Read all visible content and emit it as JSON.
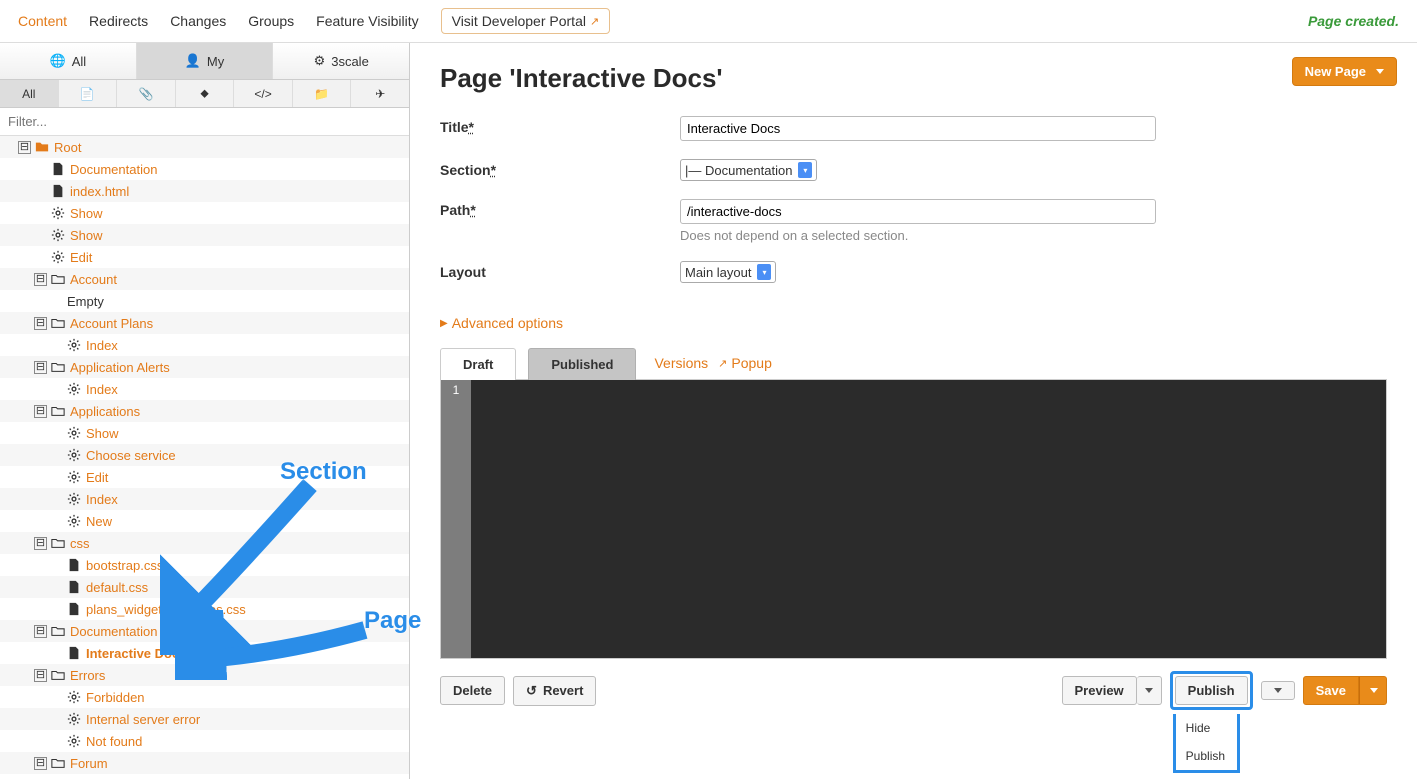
{
  "topnav": {
    "items": [
      "Content",
      "Redirects",
      "Changes",
      "Groups",
      "Feature Visibility"
    ],
    "dev_portal": "Visit Developer Portal",
    "status": "Page created."
  },
  "owner_tabs": [
    "All",
    "My",
    "3scale"
  ],
  "filter_placeholder": "Filter...",
  "tree": [
    {
      "depth": 0,
      "toggle": "-",
      "icon": "folder",
      "label": "Root",
      "link": true
    },
    {
      "depth": 1,
      "toggle": "",
      "icon": "file",
      "label": "Documentation",
      "link": true
    },
    {
      "depth": 1,
      "toggle": "",
      "icon": "file",
      "label": "index.html",
      "link": true
    },
    {
      "depth": 1,
      "toggle": "",
      "icon": "cog",
      "label": "Show",
      "link": true
    },
    {
      "depth": 1,
      "toggle": "",
      "icon": "cog",
      "label": "Show",
      "link": true
    },
    {
      "depth": 1,
      "toggle": "",
      "icon": "cog",
      "label": "Edit",
      "link": true
    },
    {
      "depth": 1,
      "toggle": "-",
      "icon": "folder-open",
      "label": "Account",
      "link": true
    },
    {
      "depth": 2,
      "toggle": "",
      "icon": "",
      "label": "Empty",
      "link": false
    },
    {
      "depth": 1,
      "toggle": "-",
      "icon": "folder-open",
      "label": "Account Plans",
      "link": true
    },
    {
      "depth": 2,
      "toggle": "",
      "icon": "cog",
      "label": "Index",
      "link": true
    },
    {
      "depth": 1,
      "toggle": "-",
      "icon": "folder-open",
      "label": "Application Alerts",
      "link": true
    },
    {
      "depth": 2,
      "toggle": "",
      "icon": "cog",
      "label": "Index",
      "link": true
    },
    {
      "depth": 1,
      "toggle": "-",
      "icon": "folder-open",
      "label": "Applications",
      "link": true
    },
    {
      "depth": 2,
      "toggle": "",
      "icon": "cog",
      "label": "Show",
      "link": true
    },
    {
      "depth": 2,
      "toggle": "",
      "icon": "cog",
      "label": "Choose service",
      "link": true
    },
    {
      "depth": 2,
      "toggle": "",
      "icon": "cog",
      "label": "Edit",
      "link": true
    },
    {
      "depth": 2,
      "toggle": "",
      "icon": "cog",
      "label": "Index",
      "link": true
    },
    {
      "depth": 2,
      "toggle": "",
      "icon": "cog",
      "label": "New",
      "link": true
    },
    {
      "depth": 1,
      "toggle": "-",
      "icon": "folder-open",
      "label": "css",
      "link": true
    },
    {
      "depth": 2,
      "toggle": "",
      "icon": "file",
      "label": "bootstrap.css",
      "link": true
    },
    {
      "depth": 2,
      "toggle": "",
      "icon": "file",
      "label": "default.css",
      "link": true
    },
    {
      "depth": 2,
      "toggle": "",
      "icon": "file",
      "label": "plans_widget_overrides.css",
      "link": true
    },
    {
      "depth": 1,
      "toggle": "-",
      "icon": "folder-open",
      "label": "Documentation",
      "link": true
    },
    {
      "depth": 2,
      "toggle": "",
      "icon": "file",
      "label": "Interactive Docs",
      "link": true,
      "bold": true
    },
    {
      "depth": 1,
      "toggle": "-",
      "icon": "folder-open",
      "label": "Errors",
      "link": true
    },
    {
      "depth": 2,
      "toggle": "",
      "icon": "cog",
      "label": "Forbidden",
      "link": true
    },
    {
      "depth": 2,
      "toggle": "",
      "icon": "cog",
      "label": "Internal server error",
      "link": true
    },
    {
      "depth": 2,
      "toggle": "",
      "icon": "cog",
      "label": "Not found",
      "link": true
    },
    {
      "depth": 1,
      "toggle": "-",
      "icon": "folder-open",
      "label": "Forum",
      "link": true
    }
  ],
  "content": {
    "new_page_btn": "New Page",
    "heading": "Page 'Interactive Docs'",
    "title_label": "Title",
    "title_value": "Interactive Docs",
    "section_label": "Section",
    "section_value": "|— Documentation",
    "path_label": "Path",
    "path_value": "/interactive-docs",
    "path_hint": "Does not depend on a selected section.",
    "layout_label": "Layout",
    "layout_value": "Main layout",
    "advanced": "Advanced options",
    "tabs": {
      "draft": "Draft",
      "published": "Published",
      "versions": "Versions",
      "popup": "Popup"
    },
    "gutter_line": "1",
    "buttons": {
      "delete": "Delete",
      "revert": "Revert",
      "preview": "Preview",
      "publish": "Publish",
      "save": "Save"
    },
    "publish_menu": [
      "Hide",
      "Publish"
    ]
  },
  "annotations": {
    "section": "Section",
    "page": "Page"
  }
}
